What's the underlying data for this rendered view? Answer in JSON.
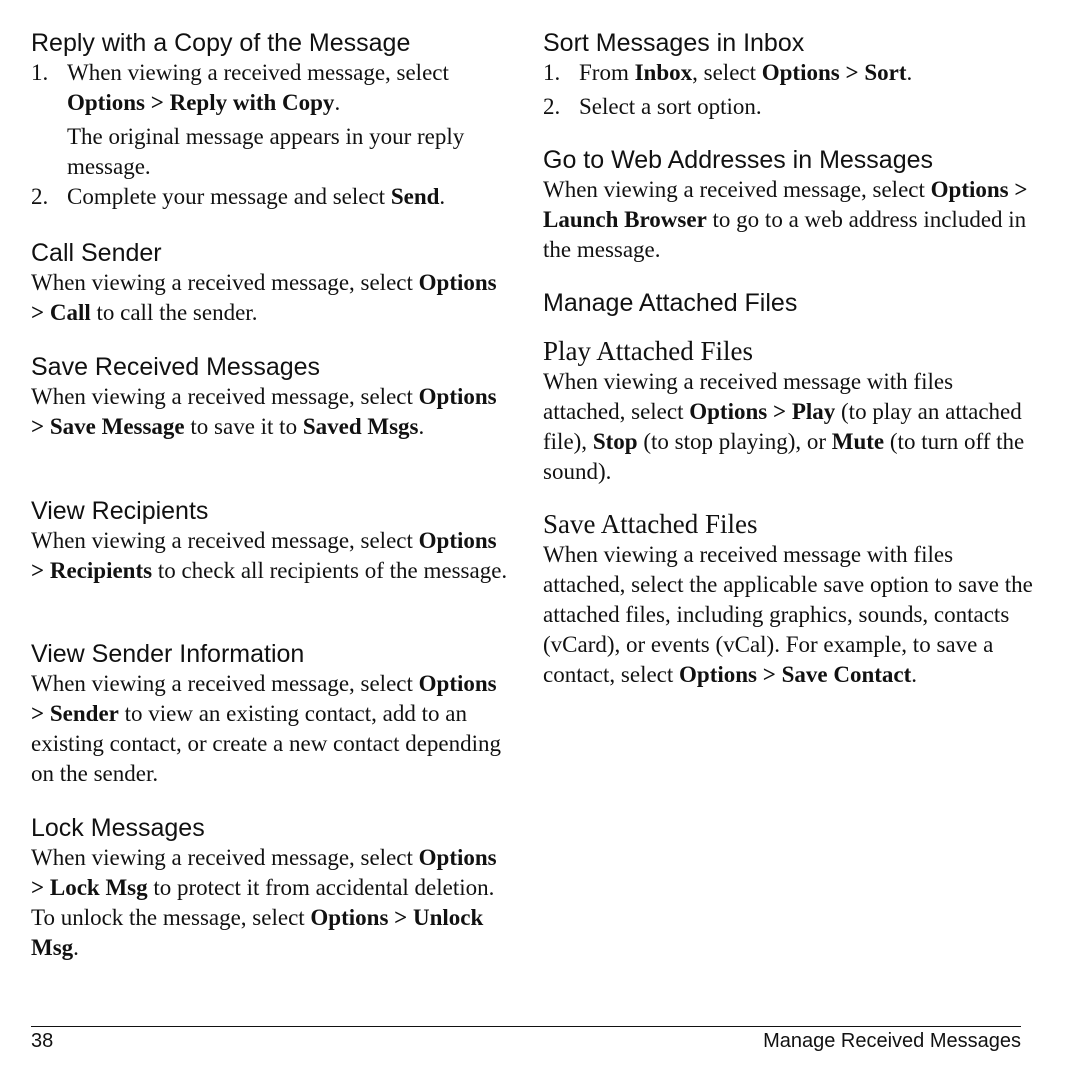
{
  "left": {
    "reply_copy": {
      "heading": "Reply with a Copy of the Message",
      "step1_num": "1.",
      "step1_a": "When viewing a received message, select ",
      "step1_b": "Options > Reply with Copy",
      "step1_c": ".",
      "step1_note": "The original message appears in your reply message.",
      "step2_num": "2.",
      "step2_a": "Complete your message and select ",
      "step2_b": "Send",
      "step2_c": "."
    },
    "call_sender": {
      "heading": "Call Sender",
      "a": "When viewing a received message, select ",
      "b": "Options > Call",
      "c": " to call the sender."
    },
    "save_received": {
      "heading": "Save Received Messages",
      "a": "When viewing a received message, select ",
      "b": "Options > Save Message",
      "c": " to save it to ",
      "d": "Saved Msgs",
      "e": "."
    },
    "view_recipients": {
      "heading": "View Recipients",
      "a": "When viewing a received message, select ",
      "b": "Options > Recipients",
      "c": " to check all recipients of the message."
    },
    "view_sender": {
      "heading": "View Sender Information",
      "a": "When viewing a received message, select ",
      "b": "Options > Sender",
      "c": " to view an existing contact, add to an existing contact, or create a new contact depending on the sender."
    },
    "lock": {
      "heading": "Lock Messages",
      "a": "When viewing a received message, select ",
      "b": "Options > Lock Msg",
      "c": " to protect it from accidental deletion. To unlock the message, select ",
      "d": "Options > Unlock Msg",
      "e": "."
    }
  },
  "right": {
    "sort": {
      "heading": "Sort Messages in Inbox",
      "step1_num": "1.",
      "step1_a": "From ",
      "step1_b": "Inbox",
      "step1_c": ", select ",
      "step1_d": "Options > Sort",
      "step1_e": ".",
      "step2_num": "2.",
      "step2_a": "Select a sort option."
    },
    "web": {
      "heading": "Go to Web Addresses in Messages",
      "a": "When viewing a received message, select ",
      "b": "Options > Launch Browser",
      "c": " to go to a web address included in the message."
    },
    "manage_attached": {
      "heading": "Manage Attached Files"
    },
    "play": {
      "heading": "Play Attached Files",
      "a": "When viewing a received message with files attached, select ",
      "b": "Options > Play",
      "c": " (to play an attached file), ",
      "d": "Stop",
      "e": " (to stop playing), or ",
      "f": "Mute",
      "g": " (to turn off the sound)."
    },
    "save_attached": {
      "heading": "Save Attached Files",
      "a": "When viewing a received message with files attached, select the applicable save option to save the attached files, including graphics, sounds, contacts (vCard), or events (vCal). For example, to save a contact, select ",
      "b": "Options > Save Contact",
      "c": "."
    }
  },
  "footer": {
    "page_number": "38",
    "section_title": "Manage Received Messages"
  }
}
